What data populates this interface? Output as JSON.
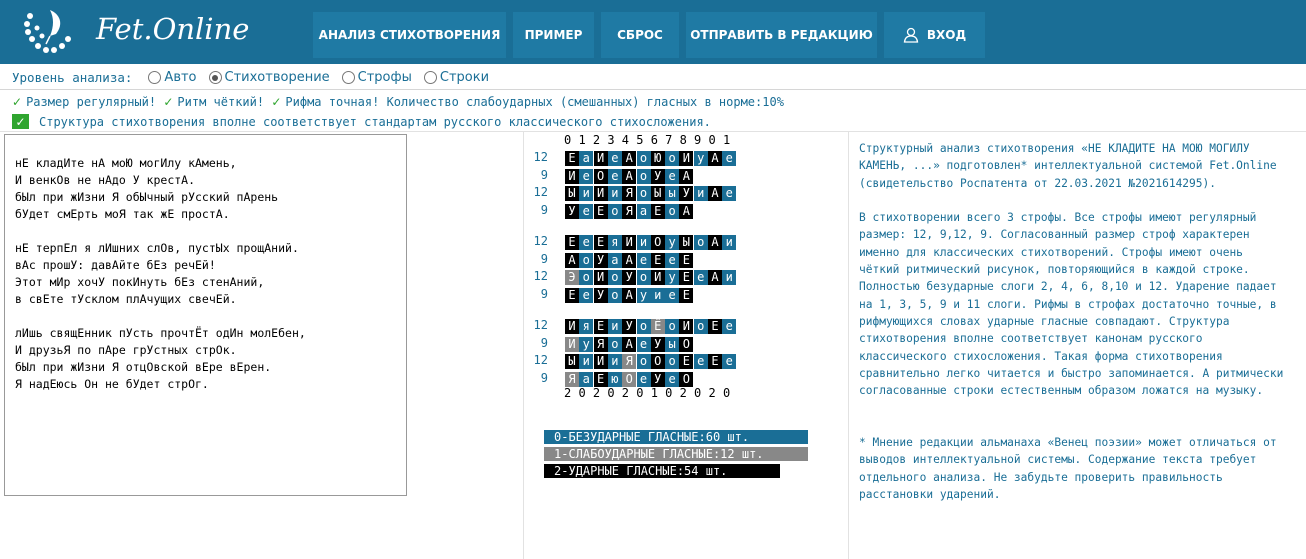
{
  "brand": {
    "title": "Fet.Online",
    "logo_icon": "quill-wreath-icon"
  },
  "nav": [
    {
      "label": "АНАЛИЗ СТИХОТВОРЕНИЯ"
    },
    {
      "label": "ПРИМЕР"
    },
    {
      "label": "СБРОС"
    },
    {
      "label": "ОТПРАВИТЬ В РЕДАКЦИЮ"
    },
    {
      "label": "ВХОД",
      "icon": "user-icon"
    }
  ],
  "analysis_level": {
    "label": "Уровень анализа:",
    "options": [
      {
        "label": "Авто",
        "selected": false
      },
      {
        "label": "Стихотворение",
        "selected": true
      },
      {
        "label": "Строфы",
        "selected": false
      },
      {
        "label": "Строки",
        "selected": false
      }
    ]
  },
  "status": {
    "line1": [
      "Размер регулярный!",
      "Ритм чёткий!",
      "Рифма точная!"
    ],
    "line1_tail": "Количество слабоударных (смешанных) гласных в норме:10%",
    "line2": "Структура стихотворения вполне соответствует стандартам русского классического стихосложения."
  },
  "poem_text": "нЕ кладИте нА моЮ могИлу кАмень,\nИ венкОв не нАдо У крестА.\nбЫл при жИзни Я обЫчный рУсский пАрень\nбУдет смЕрть моЯ так жЕ простА.\n\nнЕ терпЕл я лИшних слОв, пустЫх прощАний.\nвАс прошУ: давАйте бЕз речЕй!\nЭтот мИр хочУ покИнуть бЕз стенАний,\nв свЕте тУсклом плАчущих свечЕй.\n\nлИшь свящЕнник пУсть прочтЁт одИн молЕбен,\nИ друзьЯ по пАре грУстных стрОк.\nбЫл при жИзни Я отцОвской вЕре вЕрен.\nЯ надЕюсь Он не бУдет стрОг.",
  "scheme": {
    "digits_top": "0 1 2 3 4 5 6 7 8 9 0 1",
    "digits_bottom": "2 0 2 0 2 0 1 0 2 0 2 0",
    "colors": {
      "0": "#1a6e96",
      "1": "#888888",
      "2": "#000000"
    },
    "stanzas": [
      [
        {
          "n": "12",
          "vowels": [
            "Е",
            "а",
            "И",
            "е",
            "А",
            "о",
            "Ю",
            "о",
            "И",
            "у",
            "А",
            "е"
          ],
          "levels": [
            2,
            0,
            2,
            0,
            2,
            0,
            2,
            0,
            2,
            0,
            2,
            0
          ]
        },
        {
          "n": "9",
          "vowels": [
            "И",
            "е",
            "О",
            "е",
            "А",
            "о",
            "У",
            "е",
            "А"
          ],
          "levels": [
            2,
            0,
            2,
            0,
            2,
            0,
            2,
            0,
            2
          ]
        },
        {
          "n": "12",
          "vowels": [
            "Ы",
            "и",
            "И",
            "и",
            "Я",
            "о",
            "Ы",
            "ы",
            "У",
            "и",
            "А",
            "е"
          ],
          "levels": [
            2,
            0,
            2,
            0,
            2,
            0,
            2,
            0,
            2,
            0,
            2,
            0
          ]
        },
        {
          "n": "9",
          "vowels": [
            "У",
            "е",
            "Е",
            "о",
            "Я",
            "а",
            "Е",
            "о",
            "А"
          ],
          "levels": [
            2,
            0,
            2,
            0,
            2,
            0,
            2,
            0,
            2
          ]
        }
      ],
      [
        {
          "n": "12",
          "vowels": [
            "Е",
            "е",
            "Е",
            "я",
            "И",
            "и",
            "О",
            "у",
            "Ы",
            "о",
            "А",
            "и"
          ],
          "levels": [
            2,
            0,
            2,
            0,
            2,
            0,
            2,
            0,
            2,
            0,
            2,
            0
          ]
        },
        {
          "n": "9",
          "vowels": [
            "А",
            "о",
            "У",
            "а",
            "А",
            "е",
            "Е",
            "е",
            "Е"
          ],
          "levels": [
            2,
            0,
            2,
            0,
            2,
            0,
            2,
            0,
            2
          ]
        },
        {
          "n": "12",
          "vowels": [
            "Э",
            "о",
            "И",
            "о",
            "У",
            "о",
            "И",
            "у",
            "Е",
            "е",
            "А",
            "и"
          ],
          "levels": [
            1,
            0,
            2,
            0,
            2,
            0,
            2,
            0,
            2,
            0,
            2,
            0
          ]
        },
        {
          "n": "9",
          "vowels": [
            "Е",
            "е",
            "У",
            "о",
            "А",
            "у",
            "и",
            "е",
            "Е"
          ],
          "levels": [
            2,
            0,
            2,
            0,
            2,
            0,
            0,
            0,
            2
          ]
        }
      ],
      [
        {
          "n": "12",
          "vowels": [
            "И",
            "я",
            "Е",
            "и",
            "У",
            "о",
            "Ё",
            "о",
            "И",
            "о",
            "Е",
            "е"
          ],
          "levels": [
            2,
            0,
            2,
            0,
            2,
            0,
            1,
            0,
            2,
            0,
            2,
            0
          ]
        },
        {
          "n": "9",
          "vowels": [
            "И",
            "у",
            "Я",
            "о",
            "А",
            "е",
            "У",
            "ы",
            "О"
          ],
          "levels": [
            1,
            0,
            2,
            0,
            2,
            0,
            2,
            0,
            2
          ]
        },
        {
          "n": "12",
          "vowels": [
            "Ы",
            "и",
            "И",
            "и",
            "Я",
            "о",
            "О",
            "о",
            "Е",
            "е",
            "Е",
            "е"
          ],
          "levels": [
            2,
            0,
            2,
            0,
            1,
            0,
            2,
            0,
            2,
            0,
            2,
            0
          ]
        },
        {
          "n": "9",
          "vowels": [
            "Я",
            "а",
            "Е",
            "ю",
            "О",
            "е",
            "У",
            "е",
            "О"
          ],
          "levels": [
            1,
            0,
            2,
            0,
            1,
            0,
            2,
            0,
            2
          ]
        }
      ]
    ]
  },
  "legend": [
    {
      "label": "0-БЕЗУДАРНЫЕ ГЛАСНЫЕ:60 шт.",
      "color": "#1a6e96"
    },
    {
      "label": "1-СЛАБОУДАРНЫЕ ГЛАСНЫЕ:12 шт.",
      "color": "#888888"
    },
    {
      "label": "2-УДАРНЫЕ ГЛАСНЫЕ:54 шт.",
      "color": "#000000"
    }
  ],
  "analysis_text": "Структурный анализ стихотворения «НЕ КЛАДИТЕ НА МОЮ МОГИЛУ КАМЕНЬ, ...» подготовлен* интеллектуальной системой Fet.Online (свидетельство Роспатента от 22.03.2021 №2021614295).\n\nВ стихотворении всего 3 строфы. Все строфы имеют регулярный размер: 12, 9,12, 9. Согласованный размер строф характерен именно для классических стихотворений. Строфы имеют очень чёткий ритмический рисунок, повторяющийся в каждой строке. Полностью безударные слоги 2, 4, 6, 8,10 и 12. Ударение падает на 1, 3, 5, 9 и 11 слоги. Рифмы в строфах достаточно точные, в рифмующихся словах ударные гласные совпадают. Структура стихотворения вполне соответствует канонам русского классического стихосложения. Такая форма стихотворения сравнительно легко читается и быстро запоминается. А ритмически согласованные строки естественным образом ложатся на музыку.\n\n\n* Мнение редакции альманаха «Венец поэзии» может отличаться от выводов интеллектуальной системы. Содержание текста требует отдельного анализа. Не забудьте проверить правильность расстановки ударений."
}
